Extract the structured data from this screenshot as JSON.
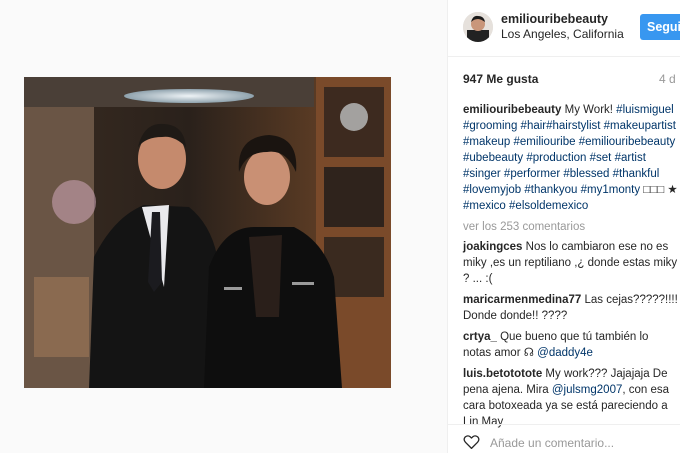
{
  "header": {
    "username": "emiliouribebeauty",
    "location": "Los Angeles, California",
    "follow_label": "Seguir"
  },
  "post": {
    "likes": "947 Me gusta",
    "time_ago": "4 d"
  },
  "caption": {
    "username": "emiliouribebeauty",
    "text": "My Work!",
    "tags": [
      "#luismiguel",
      "#grooming",
      "#hair",
      "#hairstylist",
      "#makeupartist",
      "#makeup",
      "#emiliouribe",
      "#emiliouribebeauty",
      "#ubebeauty",
      "#production",
      "#set",
      "#artist",
      "#singer",
      "#performer",
      "#blessed",
      "#thankful",
      "#lovemyjob",
      "#thankyou",
      "#my1monty"
    ],
    "symbols": "□□□",
    "star": "★",
    "tags2": [
      "#mexico",
      "#elsoldemexico"
    ]
  },
  "view_all": "ver los 253 comentarios",
  "comments": [
    {
      "user": "joakingces",
      "text": "Nos lo cambiaron ese no es miky ,es un reptiliano ,¿ donde estas miky ? ... :("
    },
    {
      "user": "maricarmenmedina77",
      "text": "Las cejas?????!!!! Donde donde!! ????"
    },
    {
      "user": "crtya_",
      "text": "Que bueno que tú también lo notas amor",
      "emoji": "☊",
      "mention": "@daddy4e"
    },
    {
      "user": "luis.betototote",
      "text": "My work??? Jajajaja De pena ajena. Mira",
      "mention": "@julsmg2007",
      "text2": ", con esa cara botoxeada ya se está pareciendo a Lin May"
    }
  ],
  "footer": {
    "add_comment_placeholder": "Añade un comentario..."
  }
}
